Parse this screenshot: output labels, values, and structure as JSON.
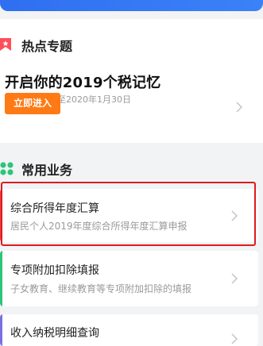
{
  "hot_topics": {
    "section_title": "热点专题",
    "promo_title": "开启你的2019个税记忆",
    "promo_subtitle": "所有数据截止至2020年1月30日",
    "promo_button": "立即进入"
  },
  "services": {
    "section_title": "常用业务",
    "items": [
      {
        "name": "综合所得年度汇算",
        "desc": "居民个人2019年度综合所得年度汇算申报",
        "accent": "#e8434f"
      },
      {
        "name": "专项附加扣除填报",
        "desc": "子女教育、继续教育等专项附加扣除的填报",
        "accent": "#2ec47a"
      },
      {
        "name": "收入纳税明细查询",
        "desc": "",
        "accent": "#7b6fe0"
      }
    ]
  },
  "colors": {
    "brand_blue": "#2f6ff0",
    "promo_button_bg": "#ff7a14",
    "highlight_border": "#e01b1b"
  },
  "icons": {
    "hot_topics": "ribbon-star-icon",
    "services": "four-dot-grid-icon",
    "chevron": "chevron-right-icon"
  }
}
